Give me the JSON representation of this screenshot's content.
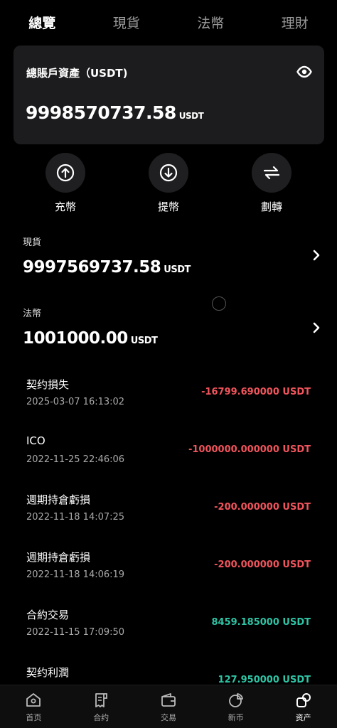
{
  "tabs": [
    "總覽",
    "現貨",
    "法幣",
    "理財"
  ],
  "account": {
    "label": "總賬戶資產（USDT)",
    "amount": "9998570737.58",
    "unit": "USDT"
  },
  "actions": {
    "deposit": "充幣",
    "withdraw": "提幣",
    "transfer": "劃轉"
  },
  "spot": {
    "label": "現貨",
    "amount": "9997569737.58",
    "unit": "USDT"
  },
  "fiat": {
    "label": "法幣",
    "amount": "1001000.00",
    "unit": "USDT"
  },
  "records": [
    {
      "title": "契约損失",
      "time": "2025-03-07 16:13:02",
      "amount": "-16799.690000 USDT",
      "sign": "neg"
    },
    {
      "title": "ICO",
      "time": "2022-11-25 22:46:06",
      "amount": "-1000000.000000 USDT",
      "sign": "neg"
    },
    {
      "title": "週期持倉虧損",
      "time": "2022-11-18 14:07:25",
      "amount": "-200.000000 USDT",
      "sign": "neg"
    },
    {
      "title": "週期持倉虧損",
      "time": "2022-11-18 14:06:19",
      "amount": "-200.000000 USDT",
      "sign": "neg"
    },
    {
      "title": "合約交易",
      "time": "2022-11-15 17:09:50",
      "amount": "8459.185000 USDT",
      "sign": "pos"
    },
    {
      "title": "契约利潤",
      "time": "",
      "amount": "127.950000 USDT",
      "sign": "pos"
    }
  ],
  "nav": {
    "home": "首页",
    "contract": "合约",
    "trade": "交易",
    "new_coin": "新币",
    "assets": "资产"
  },
  "colors": {
    "negative": "#f0545c",
    "positive": "#2ec4a5",
    "card": "#1c1c1e"
  },
  "icons": {
    "eye": "eye-icon",
    "deposit": "arrow-up-circle-icon",
    "withdraw": "arrow-down-circle-icon",
    "transfer": "swap-arrows-icon",
    "chevron": "chevron-right-icon",
    "home": "home-icon",
    "contract": "receipt-icon",
    "trade": "wallet-icon",
    "new_coin": "pie-chart-icon",
    "assets": "assets-icon"
  }
}
